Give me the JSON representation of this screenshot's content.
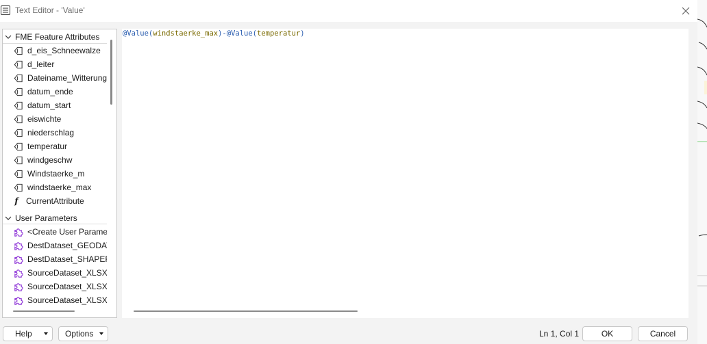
{
  "window": {
    "title": "Text Editor - 'Value'"
  },
  "sidebar": {
    "feature_header": "FME Feature Attributes",
    "attributes": [
      "d_eis_Schneewalze",
      "d_leiter",
      "Dateiname_Witterung",
      "datum_ende",
      "datum_start",
      "eiswichte",
      "niederschlag",
      "temperatur",
      "windgeschw",
      "Windstaerke_m",
      "windstaerke_max"
    ],
    "function_item": "CurrentAttribute",
    "params_header": "User Parameters",
    "parameters": [
      "<Create User Parameter>",
      "DestDataset_GEODATABASE",
      "DestDataset_SHAPEFILE",
      "SourceDataset_XLSXR",
      "SourceDataset_XLSXR",
      "SourceDataset_XLSXR"
    ]
  },
  "editor": {
    "tokens": [
      {
        "text": "@Value(",
        "kind": "fn"
      },
      {
        "text": "windstaerke_max",
        "kind": "arg"
      },
      {
        "text": ")-",
        "kind": "fn"
      },
      {
        "text": "@Value(",
        "kind": "fn"
      },
      {
        "text": "temperatur",
        "kind": "arg"
      },
      {
        "text": ")",
        "kind": "fn"
      }
    ]
  },
  "footer": {
    "help_label": "Help",
    "options_label": "Options",
    "cursor_status": "Ln 1, Col 1",
    "ok_label": "OK",
    "cancel_label": "Cancel"
  },
  "icons": {
    "attribute": "attribute-icon",
    "function": "function-icon",
    "parameter": "puzzle-icon"
  },
  "colors": {
    "function_token": "#2a5db0",
    "argument_token": "#7a6a00",
    "parameter_icon": "#8b2fd6"
  }
}
